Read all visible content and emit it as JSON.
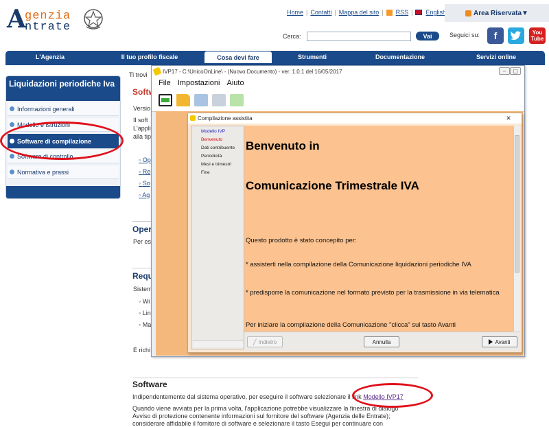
{
  "brand": {
    "logo_letter": "A",
    "logo_line1": "genzia",
    "logo_line2": "ntrate"
  },
  "header": {
    "links": [
      "Home",
      "Contatti",
      "Mappa del sito",
      "RSS",
      "English"
    ],
    "area_riservata": "Area Riservata▼",
    "search_label": "Cerca:",
    "search_button": "Vai",
    "social_label": "Seguici su:",
    "youtube_label_1": "You",
    "youtube_label_2": "Tube"
  },
  "nav": {
    "items": [
      "L'Agenzia",
      "Il tuo profilo fiscale",
      "Cosa devi fare",
      "Strumenti",
      "Documentazione",
      "Servizi online"
    ],
    "active_index": 2
  },
  "sidebar": {
    "title": "Liquidazioni periodiche Iva",
    "items": [
      "Informazioni generali",
      "Modello e istruzioni",
      "Software di compilazione",
      "Software di controllo",
      "Normativa e prassi"
    ],
    "selected_index": 2
  },
  "main": {
    "breadcrumb": "Ti trovi",
    "heading": "Softw",
    "version": "Versio",
    "intro": [
      "Il   soft",
      "L'applic",
      "alla tip"
    ],
    "bullets": [
      "Op",
      "Re",
      "So",
      "Ag"
    ],
    "section_open": "Oper",
    "section_open_text": "Per es",
    "section_req": "Requ",
    "section_req_text": "Sistem",
    "req_bullets": [
      "Wi",
      "Lin",
      "Ma"
    ],
    "richiesto": "È richi",
    "software_title": "Software",
    "software_p1_before": "Indipendentemente dal sistema operativo, per eseguire il software selezionare il link",
    "software_link": "Modello IVP17",
    "software_p2_l1": "Quando viene avviata per la prima volta, l'applicazione potrebbe visualizzare la finestra di dialogo",
    "software_p2_l2": "Avviso di protezione contenente informazioni sul fornitore del software (Agenzia delle Entrate);",
    "software_p2_l3": "considerare affidabile il fornitore di software e selezionare il tasto Esegui per continuare con"
  },
  "app": {
    "title": "IVP17 - C:\\UnicoOnLine\\ - (Nuovo Documento)  -  ver. 1.0.1 del 16/05/2017",
    "menu": [
      "File",
      "Impostazioni",
      "Aiuto"
    ],
    "window_buttons": [
      "–",
      "▢",
      "✕"
    ]
  },
  "dialog": {
    "title": "Compilazione assistita",
    "close": "✕",
    "steps": [
      "Modello IVP",
      "Benvenuto",
      "Dati contribuente",
      "Periodicità",
      "Mesi e trimestri",
      "Fine"
    ],
    "current_step": 1,
    "heading1": "Benvenuto in",
    "heading2": "Comunicazione Trimestrale IVA",
    "p1": "Questo prodotto è stato concepito per:",
    "p2": "*    assisterti nella compilazione della Comunicazione liquidazioni periodiche IVA",
    "p3": "*    predisporre la comunicazione nel formato previsto per la trasmissione in via telematica",
    "p4": "Per iniziare la compilazione della Comunicazione \"clicca\" sul tasto Avanti",
    "buttons": {
      "back": "Indietro",
      "cancel": "Annulla",
      "next": "Avanti"
    }
  },
  "colors": {
    "brand_blue": "#1a4a8a",
    "accent_orange": "#e06a10",
    "highlight_red": "#e0101a",
    "canvas_orange": "#f4b87c"
  }
}
